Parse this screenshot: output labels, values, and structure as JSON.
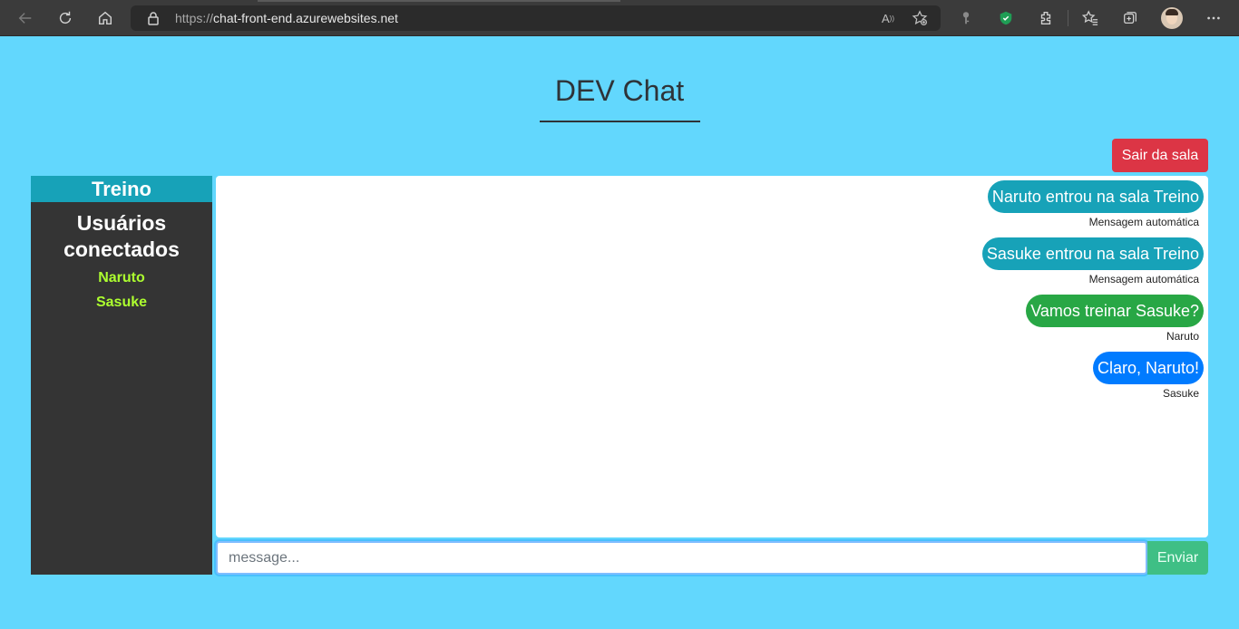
{
  "browser": {
    "url_protocol": "https://",
    "url_host": "chat-front-end.azurewebsites.net"
  },
  "page": {
    "title": "DEV Chat",
    "leave_button": "Sair da sala",
    "room_name": "Treino",
    "users_title": "Usuários conectados",
    "users": [
      "Naruto",
      "Sasuke"
    ],
    "input_placeholder": "message...",
    "send_button": "Enviar"
  },
  "messages": [
    {
      "text": "Naruto entrou na sala Treino",
      "author": "Mensagem automática",
      "color": "#17a2b8"
    },
    {
      "text": "Sasuke entrou na sala Treino",
      "author": "Mensagem automática",
      "color": "#17a2b8"
    },
    {
      "text": "Vamos treinar Sasuke?",
      "author": "Naruto",
      "color": "#28a745"
    },
    {
      "text": "Claro, Naruto!",
      "author": "Sasuke",
      "color": "#007bff"
    }
  ],
  "colors": {
    "page_bg": "#62d7fd",
    "sidebar_bg": "#343434",
    "room_header": "#17a2b8",
    "leave_button": "#dc3545",
    "send_button": "#3fbf85",
    "user_name": "#adff2f"
  }
}
